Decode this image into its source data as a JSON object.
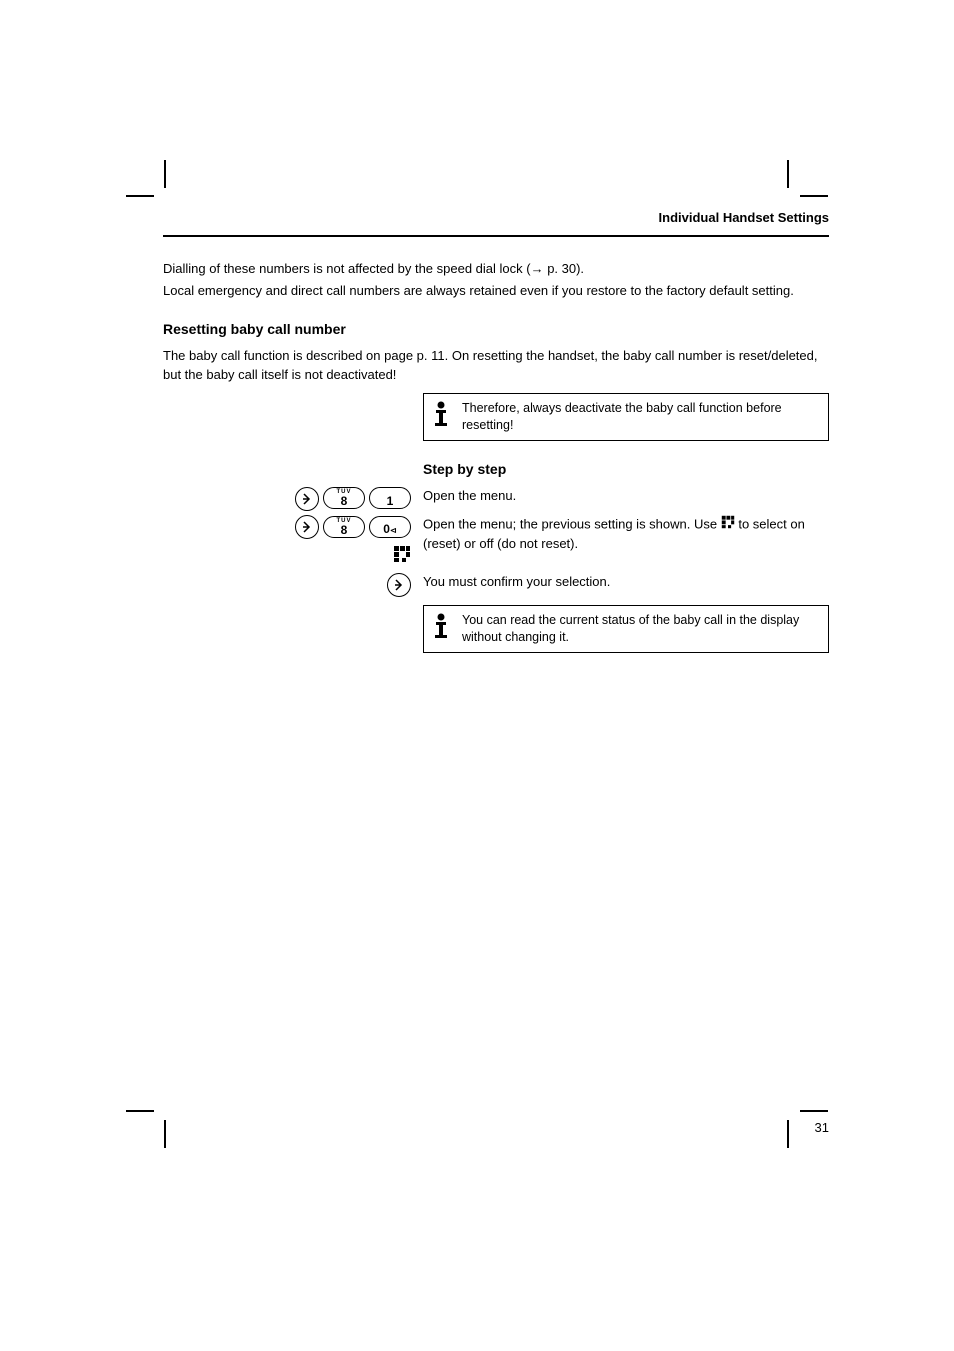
{
  "header": {
    "title": "Individual Handset Settings"
  },
  "content": {
    "intro1": "Dialling of these numbers is not affected by the speed dial lock (→ p. 30).",
    "intro2": "Local emergency and direct call numbers are always retained even if you restore to the factory default setting.",
    "sec1_title": "Resetting baby call number",
    "sec1_p1": "The baby call function is described on page p. 11. On resetting the handset, the baby call number is reset/deleted, but the baby call itself is not deactivated!",
    "info1": "Therefore, always deactivate the baby call function before resetting!",
    "sec2_title": "Step by step",
    "row1_label": "Open the menu.",
    "row2_label_a": "Open the menu; the previous setting is shown. Use ",
    "row2_label_b": " to select on (reset) or off (do not reset).",
    "row3_label": "You must confirm your selection.",
    "info2": "You can read the current status of the baby call in the display without changing it."
  },
  "buttons": {
    "arrow_right": "→",
    "key_8_sup": "TUV",
    "key_8_main": "8",
    "key_1_main": "1",
    "key_0_main": "0",
    "key_0_sub": "⊲"
  },
  "page_number": "31"
}
